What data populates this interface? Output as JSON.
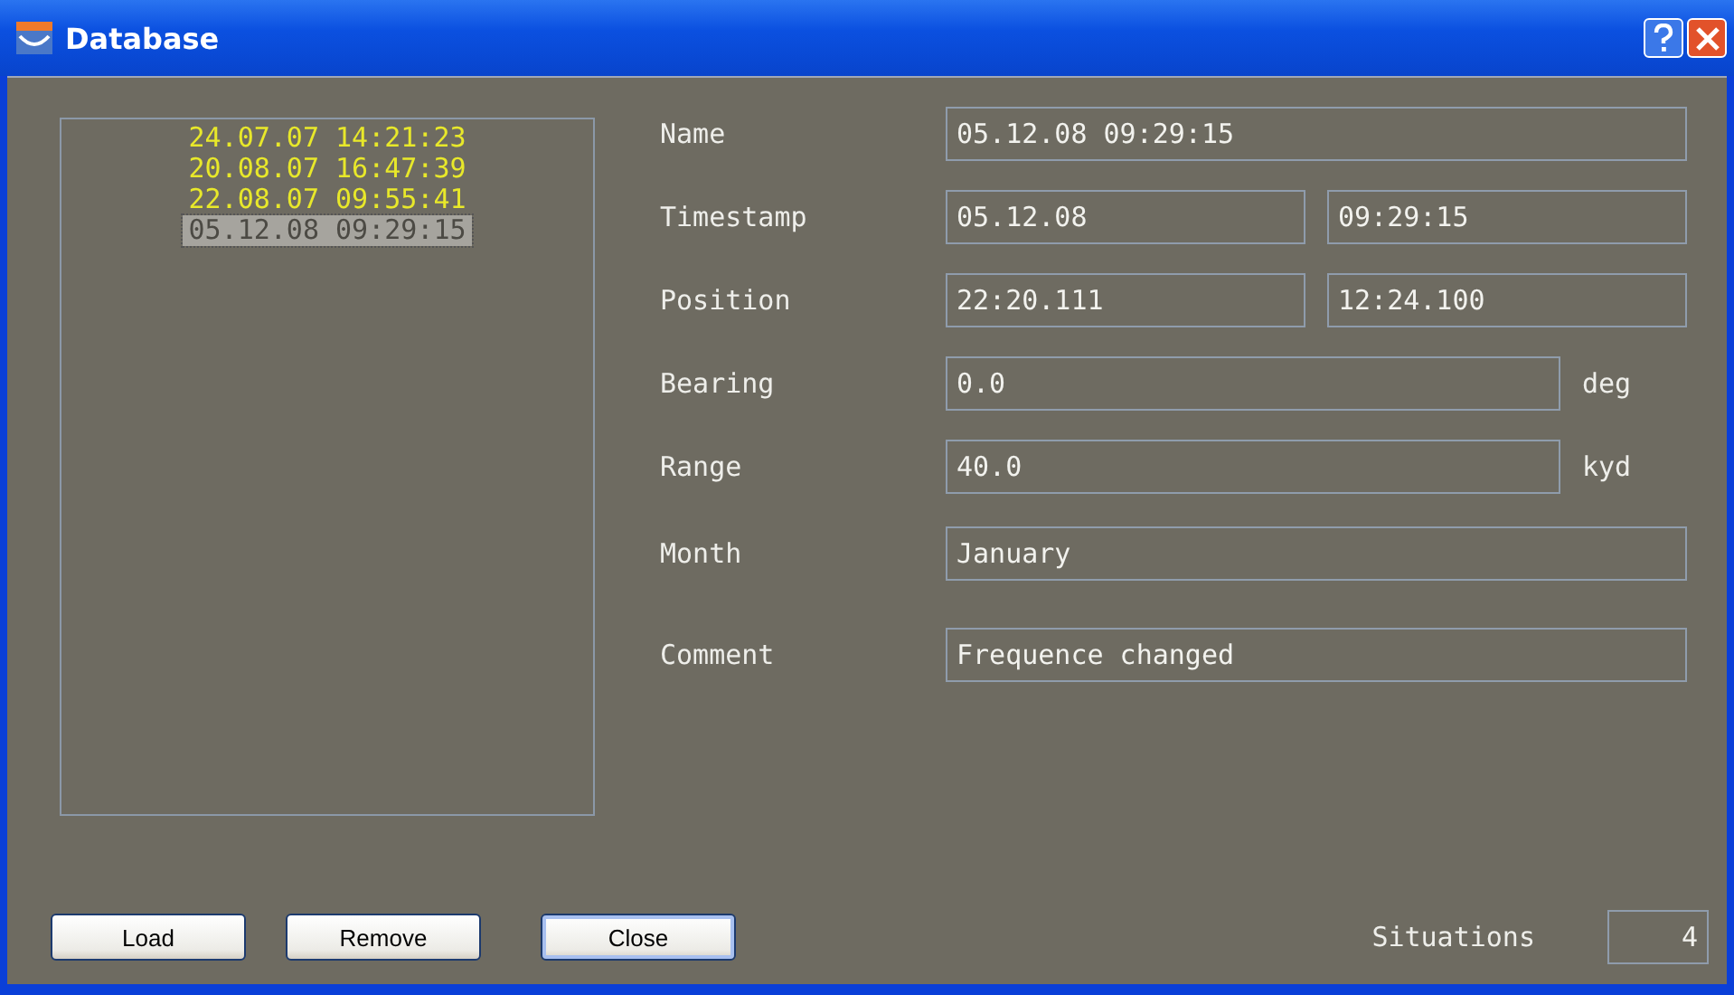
{
  "window": {
    "title": "Database"
  },
  "list": [
    {
      "label": "24.07.07 14:21:23",
      "selected": false
    },
    {
      "label": "20.08.07 16:47:39",
      "selected": false
    },
    {
      "label": "22.08.07 09:55:41",
      "selected": false
    },
    {
      "label": "05.12.08 09:29:15",
      "selected": true
    }
  ],
  "fields": [
    {
      "label": "Name",
      "kind": "single",
      "values": [
        "05.12.08 09:29:15"
      ]
    },
    {
      "label": "Timestamp",
      "kind": "pair",
      "values": [
        "05.12.08",
        "09:29:15"
      ]
    },
    {
      "label": "Position",
      "kind": "pair",
      "values": [
        "22:20.111",
        "12:24.100"
      ]
    },
    {
      "label": "Bearing",
      "kind": "unit",
      "values": [
        "0.0"
      ],
      "unit": "deg"
    },
    {
      "label": "Range",
      "kind": "unit",
      "values": [
        "40.0"
      ],
      "unit": "kyd"
    },
    {
      "label": "Month",
      "kind": "single",
      "values": [
        "January"
      ]
    },
    {
      "label": "Comment",
      "kind": "single",
      "values": [
        "Frequence changed"
      ]
    }
  ],
  "buttons": [
    "Load",
    "Remove",
    "Close"
  ],
  "situations": {
    "label": "Situations",
    "value": "4"
  }
}
